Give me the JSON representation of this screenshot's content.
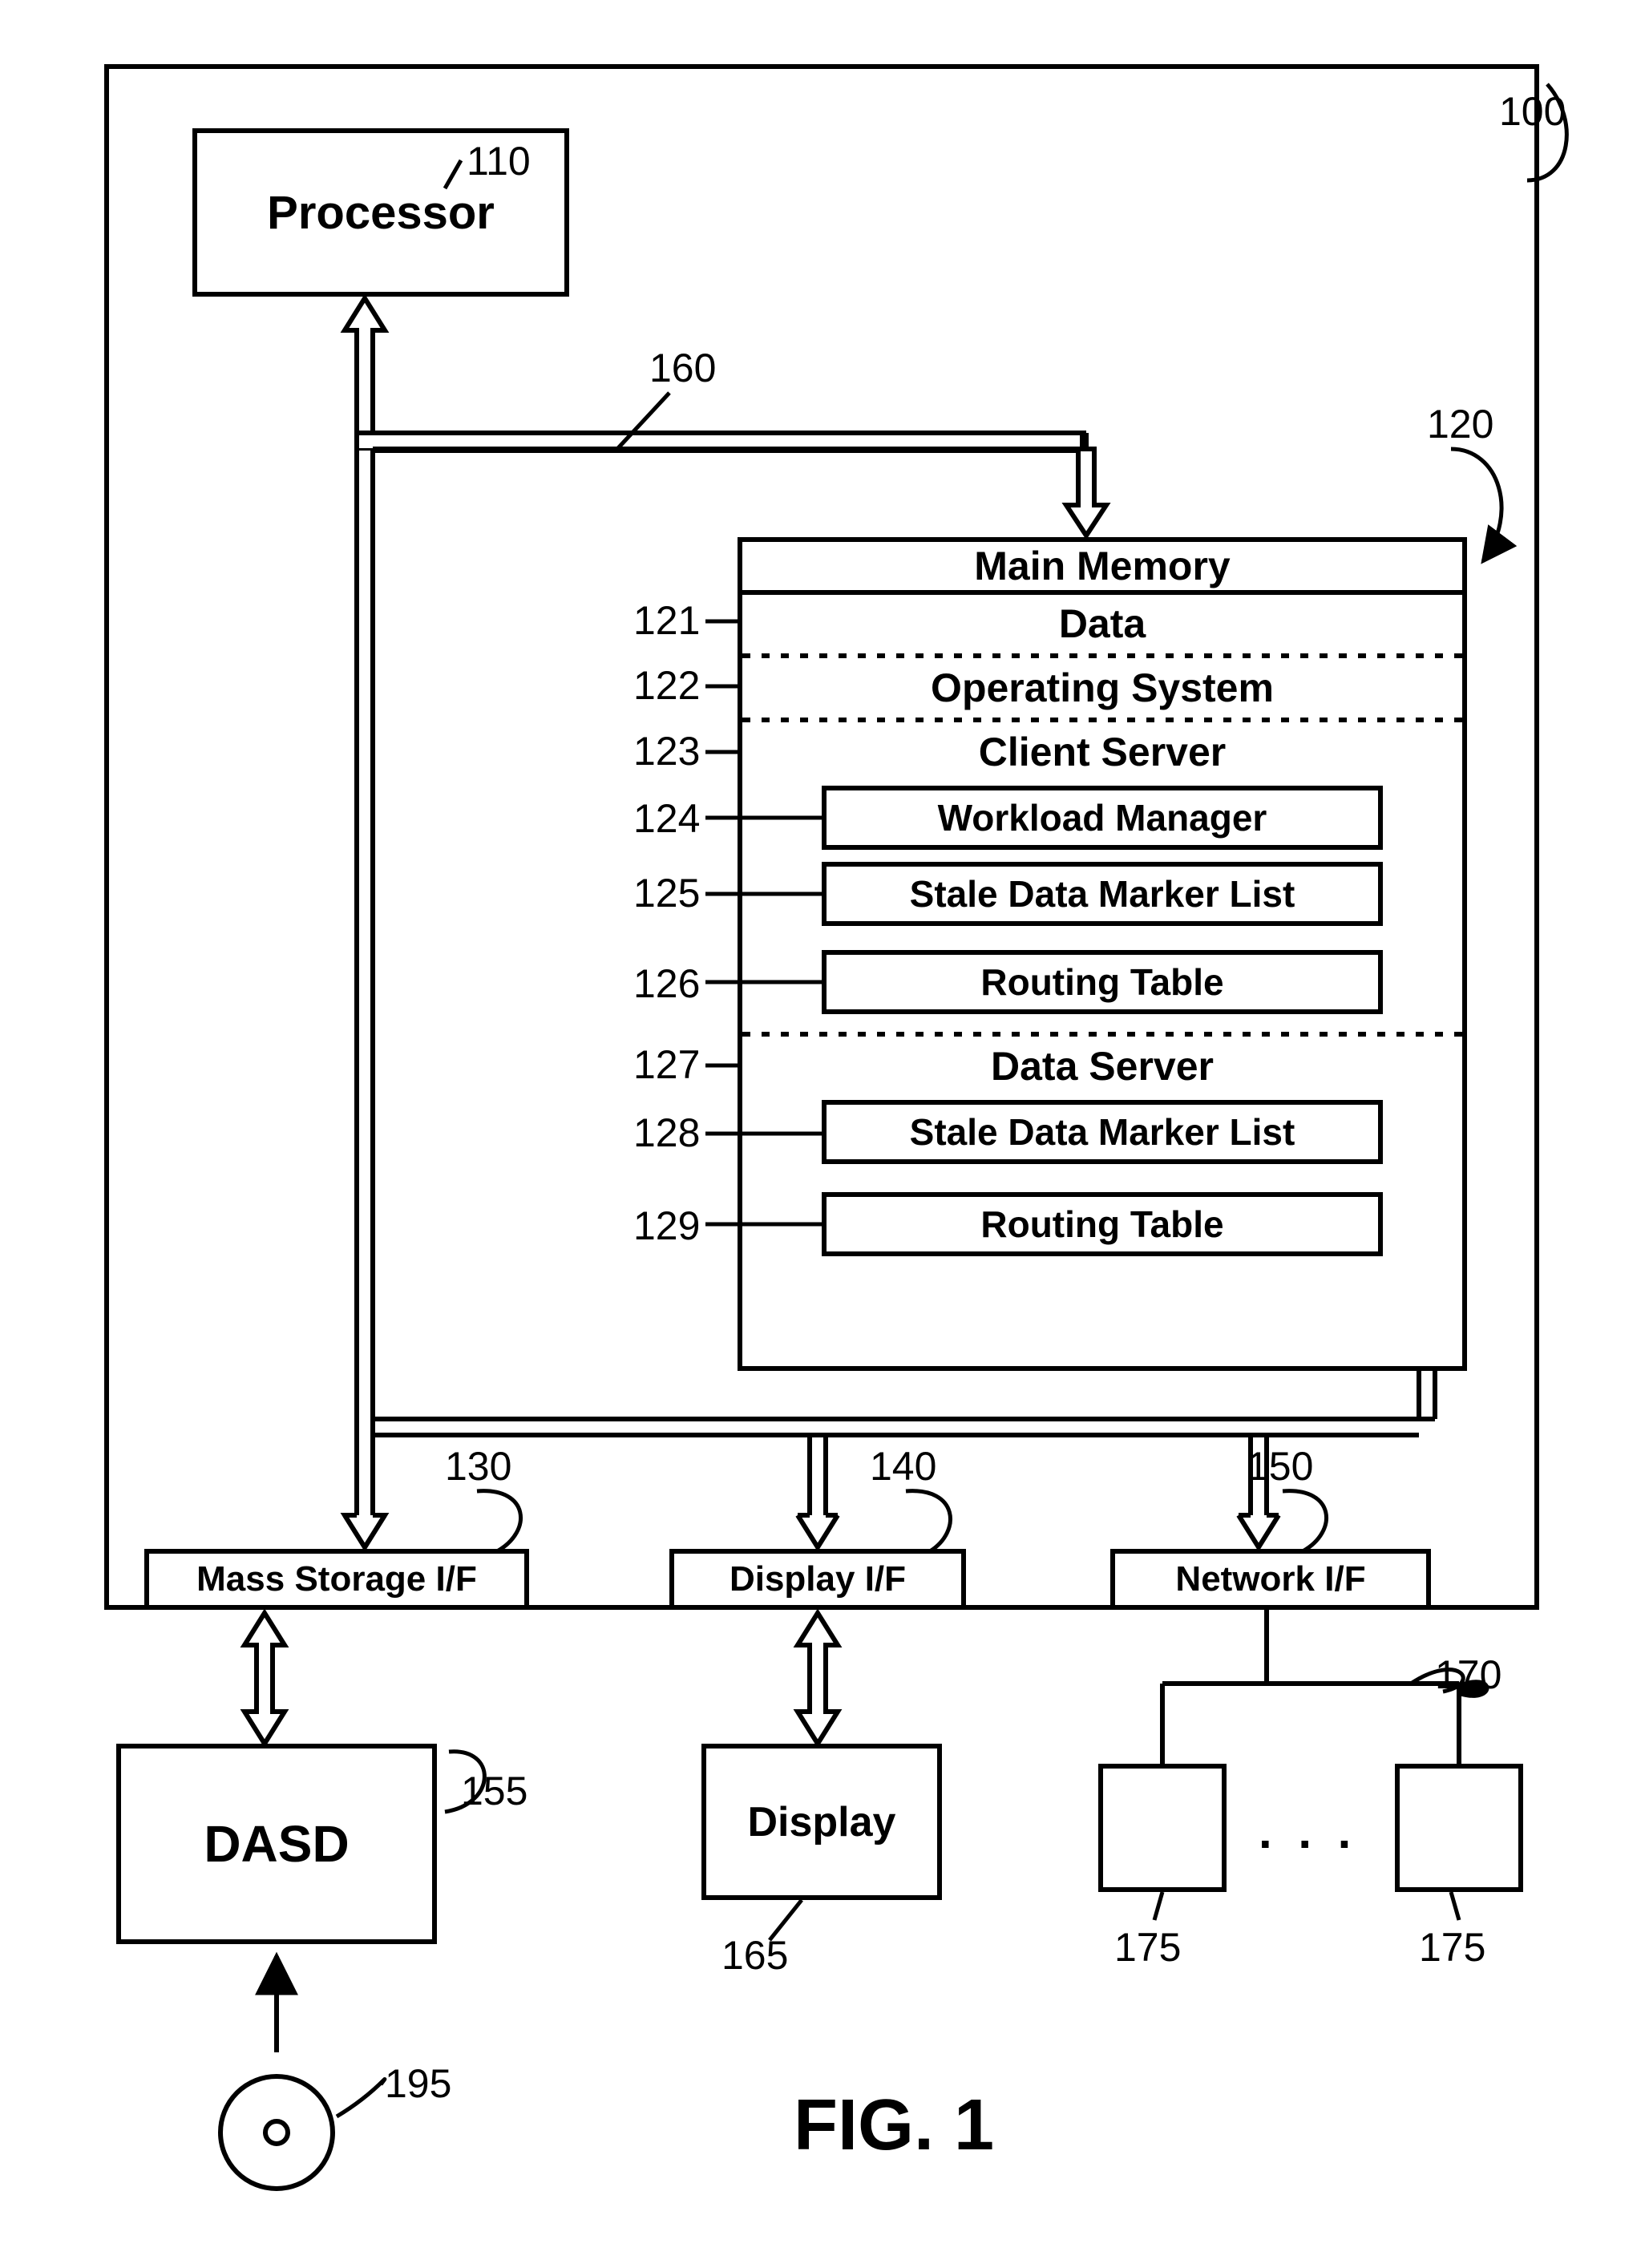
{
  "figure_caption": "FIG. 1",
  "refs": {
    "system": "100",
    "processor": "110",
    "main_memory": "120",
    "data": "121",
    "os": "122",
    "client_server": "123",
    "workload_manager": "124",
    "stale_list_1": "125",
    "routing_table_1": "126",
    "data_server": "127",
    "stale_list_2": "128",
    "routing_table_2": "129",
    "mass_storage_if": "130",
    "display_if": "140",
    "network_if": "150",
    "dasd": "155",
    "bus": "160",
    "display": "165",
    "nodes": "170",
    "node_a": "175",
    "node_b": "175",
    "media": "195"
  },
  "blocks": {
    "processor": "Processor",
    "main_memory": "Main Memory",
    "data": "Data",
    "os": "Operating System",
    "client_server": "Client Server",
    "workload_manager": "Workload Manager",
    "stale_list_1": "Stale Data Marker List",
    "routing_table_1": "Routing Table",
    "data_server": "Data Server",
    "stale_list_2": "Stale Data Marker List",
    "routing_table_2": "Routing Table",
    "mass_storage_if": "Mass Storage I/F",
    "display_if": "Display I/F",
    "network_if": "Network I/F",
    "dasd": "DASD",
    "display": "Display",
    "ellipsis": ". . ."
  },
  "chart_data": {
    "type": "diagram",
    "title": "FIG. 1",
    "description": "Block diagram of computer system 100 with processor, main memory hierarchy, system bus, and I/O interfaces.",
    "nodes": [
      {
        "id": "100",
        "label": "System boundary"
      },
      {
        "id": "110",
        "label": "Processor"
      },
      {
        "id": "160",
        "label": "System bus"
      },
      {
        "id": "120",
        "label": "Main Memory"
      },
      {
        "id": "121",
        "label": "Data",
        "parent": "120"
      },
      {
        "id": "122",
        "label": "Operating System",
        "parent": "120"
      },
      {
        "id": "123",
        "label": "Client Server",
        "parent": "120"
      },
      {
        "id": "124",
        "label": "Workload Manager",
        "parent": "123"
      },
      {
        "id": "125",
        "label": "Stale Data Marker List",
        "parent": "123"
      },
      {
        "id": "126",
        "label": "Routing Table",
        "parent": "123"
      },
      {
        "id": "127",
        "label": "Data Server",
        "parent": "120"
      },
      {
        "id": "128",
        "label": "Stale Data Marker List",
        "parent": "127"
      },
      {
        "id": "129",
        "label": "Routing Table",
        "parent": "127"
      },
      {
        "id": "130",
        "label": "Mass Storage I/F"
      },
      {
        "id": "140",
        "label": "Display I/F"
      },
      {
        "id": "150",
        "label": "Network I/F"
      },
      {
        "id": "155",
        "label": "DASD"
      },
      {
        "id": "165",
        "label": "Display"
      },
      {
        "id": "170",
        "label": "Network nodes group"
      },
      {
        "id": "175a",
        "label": "Network node",
        "parent": "170"
      },
      {
        "id": "175b",
        "label": "Network node",
        "parent": "170"
      },
      {
        "id": "195",
        "label": "Removable media (disc)"
      }
    ],
    "edges": [
      {
        "from": "110",
        "to": "160",
        "style": "bidirectional",
        "label": "processor ↔ bus"
      },
      {
        "from": "160",
        "to": "120",
        "style": "bidirectional",
        "label": "bus ↔ main memory"
      },
      {
        "from": "160",
        "to": "130",
        "style": "bidirectional",
        "label": "bus ↔ mass storage I/F"
      },
      {
        "from": "160",
        "to": "140",
        "style": "bidirectional",
        "label": "bus ↔ display I/F"
      },
      {
        "from": "160",
        "to": "150",
        "style": "bidirectional",
        "label": "bus ↔ network I/F"
      },
      {
        "from": "130",
        "to": "155",
        "style": "bidirectional",
        "label": "mass storage I/F ↔ DASD"
      },
      {
        "from": "140",
        "to": "165",
        "style": "bidirectional",
        "label": "display I/F ↔ Display"
      },
      {
        "from": "150",
        "to": "170",
        "style": "unidirectional"
      },
      {
        "from": "170",
        "to": "175a",
        "style": "unidirectional"
      },
      {
        "from": "170",
        "to": "175b",
        "style": "unidirectional"
      },
      {
        "from": "195",
        "to": "155",
        "style": "unidirectional",
        "label": "media input"
      }
    ]
  }
}
